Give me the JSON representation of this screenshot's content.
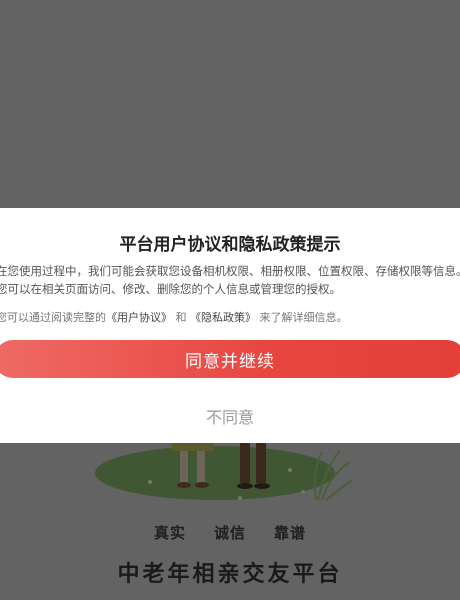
{
  "dialog": {
    "title": "平台用户协议和隐私政策提示",
    "line1": "在您使用过程中，我们可能会获取您设备相机权限、相册权限、位置权限、存储权限等信息。",
    "line2": "您可以在相关页面访问、修改、删除您的个人信息或管理您的授权。",
    "note_prefix": "您可以通过阅读完整的",
    "user_agreement_link": "《用户协议》",
    "note_and": "和",
    "privacy_policy_link": "《隐私政策》",
    "note_suffix": "来了解详细信息。",
    "agree_label": "同意并继续",
    "disagree_label": "不同意"
  },
  "splash": {
    "tagline": [
      "真实",
      "诚信",
      "靠谱"
    ],
    "title": "中老年相亲交友平台"
  }
}
